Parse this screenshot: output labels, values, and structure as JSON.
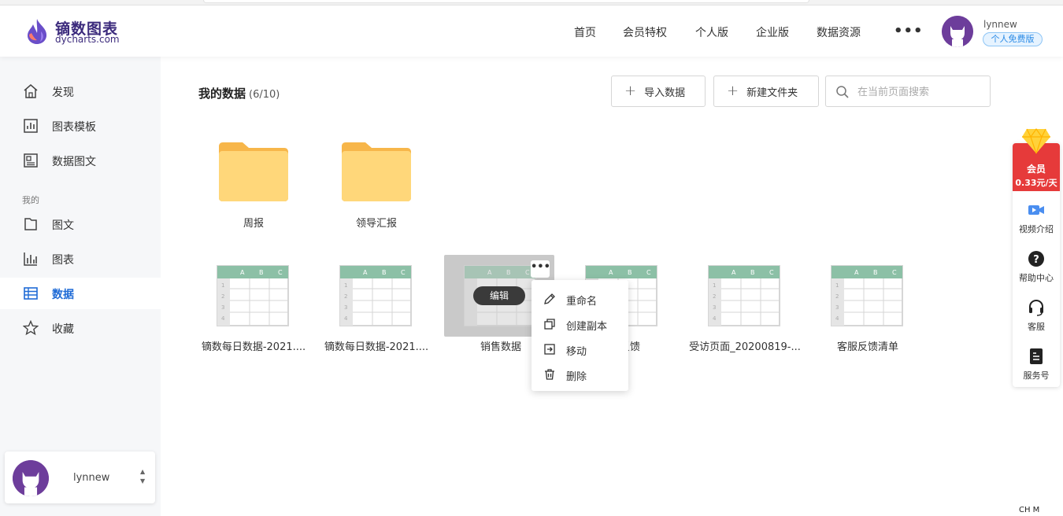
{
  "brand": {
    "name_cn": "镝数图表",
    "domain": "dycharts.com"
  },
  "nav": [
    "首页",
    "会员特权",
    "个人版",
    "企业版",
    "数据资源"
  ],
  "nav_more": "•••",
  "user": {
    "name": "lynnew",
    "plan": "个人免费版"
  },
  "sidebar": {
    "top_items": [
      {
        "label": "发现",
        "icon": "home-icon"
      },
      {
        "label": "图表模板",
        "icon": "chart-template-icon"
      },
      {
        "label": "数据图文",
        "icon": "article-icon"
      }
    ],
    "section": "我的",
    "my_items": [
      {
        "label": "图文",
        "icon": "document-icon"
      },
      {
        "label": "图表",
        "icon": "bar-chart-icon"
      },
      {
        "label": "数据",
        "icon": "table-icon",
        "active": true
      },
      {
        "label": "收藏",
        "icon": "star-icon"
      }
    ],
    "user_name": "lynnew"
  },
  "main": {
    "title": "我的数据",
    "count": "(6/10)",
    "import_label": "导入数据",
    "new_folder_label": "新建文件夹",
    "search_placeholder": "在当前页面搜索",
    "folders": [
      "周报",
      "领导汇报"
    ],
    "files": [
      "镝数每日数据-2021....",
      "镝数每日数据-2021....",
      "销售数据",
      "反馈",
      "受访页面_20200819-...",
      "客服反馈清单"
    ],
    "edit_label": "编辑",
    "more_label": "•••",
    "sheet_cols": [
      "A",
      "B",
      "C"
    ],
    "sheet_rows": [
      "1",
      "2",
      "3",
      "4"
    ]
  },
  "context_menu": [
    "重命名",
    "创建副本",
    "移动",
    "删除"
  ],
  "float_panel": {
    "vip_title": "会员",
    "vip_price": "0.33元/天",
    "items": [
      "视频介绍",
      "帮助中心",
      "客服",
      "服务号"
    ]
  },
  "corner_text": "CH M"
}
